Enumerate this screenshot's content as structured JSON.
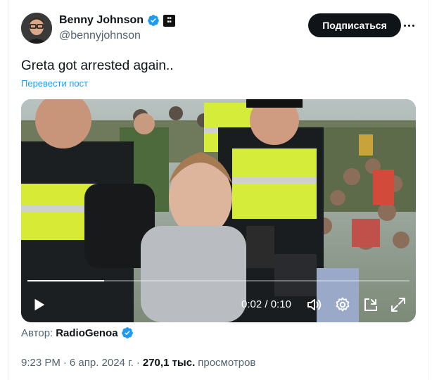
{
  "author": {
    "name": "Benny Johnson",
    "handle": "@bennyjohnson"
  },
  "header": {
    "subscribe_label": "Подписаться"
  },
  "tweet": {
    "text": "Greta got arrested again..",
    "translate_label": "Перевести пост"
  },
  "video": {
    "current_time": "0:02",
    "separator": "/",
    "duration": "0:10",
    "progress_fraction": 0.2,
    "source_label": "Автор:",
    "source_name": "RadioGenoa"
  },
  "meta": {
    "time": "9:23 PM",
    "dot": "·",
    "date": "6 апр. 2024 г.",
    "dot2": "·",
    "views_count": "270,1 тыс.",
    "views_label": "просмотров"
  },
  "colors": {
    "verified": "#1d9bf0",
    "link": "#1d9bf0",
    "button_bg": "#0f1419",
    "secondary_text": "#536471"
  },
  "icons": {
    "verified": "verified-badge-icon",
    "affiliate": "affiliate-badge-icon",
    "more": "more-dots-icon",
    "play": "play-icon",
    "volume": "volume-icon",
    "settings": "settings-gear-icon",
    "pip": "picture-in-picture-icon",
    "fullscreen": "fullscreen-icon"
  }
}
